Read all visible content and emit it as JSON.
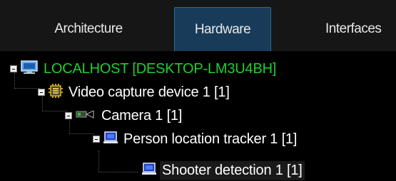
{
  "tabs": [
    {
      "label": "Architecture"
    },
    {
      "label": "Hardware"
    },
    {
      "label": "Interfaces"
    }
  ],
  "tree": {
    "root": {
      "label": "LOCALHOST [DESKTOP-LM3U4BH]",
      "icon": "computer-icon"
    },
    "capture_device": {
      "label": "Video capture device 1 [1]",
      "icon": "chip-icon"
    },
    "camera": {
      "label": "Camera 1 [1]",
      "icon": "camera-icon"
    },
    "tracker": {
      "label": "Person location tracker 1 [1]",
      "icon": "monitor-icon"
    },
    "detection": {
      "label": "Shooter detection 1 [1]",
      "icon": "monitor-icon"
    }
  },
  "colors": {
    "root_text": "#1fd12d",
    "active_tab": "#183b5a",
    "active_tab_border": "#2d6a99"
  }
}
